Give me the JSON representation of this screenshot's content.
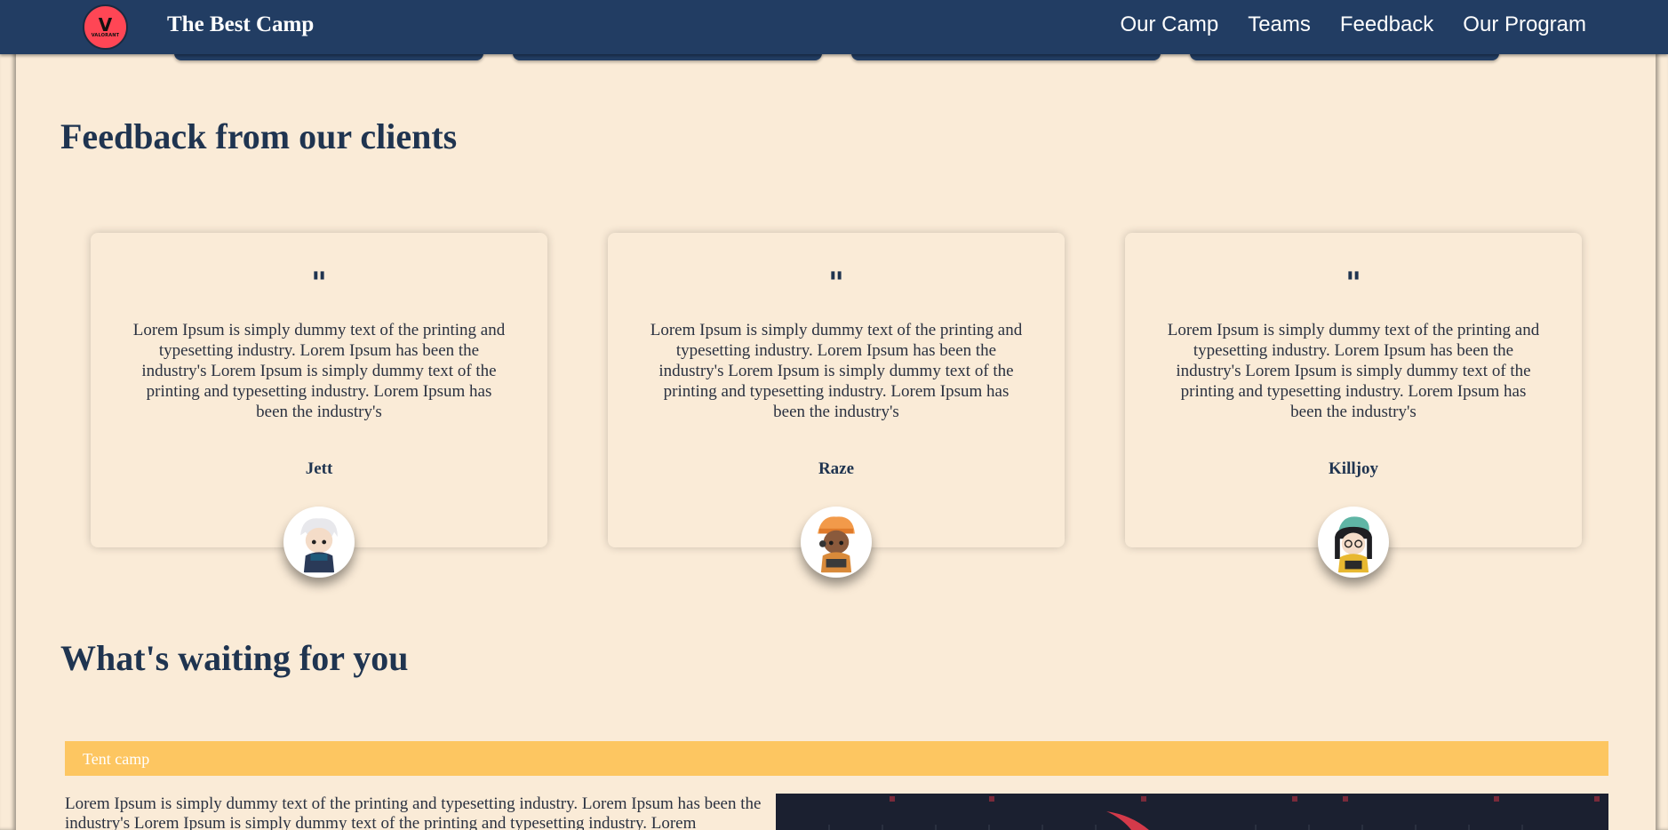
{
  "navbar": {
    "logo_text": "VALORANT",
    "brand": "The Best Camp",
    "links": [
      "Our Camp",
      "Teams",
      "Feedback",
      "Our Program"
    ]
  },
  "feedback": {
    "title": "Feedback from our clients",
    "quote_mark": "\"",
    "cards": [
      {
        "text": "Lorem Ipsum is simply dummy text of the printing and typesetting industry. Lorem Ipsum has been the industry's Lorem Ipsum is simply dummy text of the printing and typesetting industry. Lorem Ipsum has been the industry's",
        "name": "Jett"
      },
      {
        "text": "Lorem Ipsum is simply dummy text of the printing and typesetting industry. Lorem Ipsum has been the industry's Lorem Ipsum is simply dummy text of the printing and typesetting industry. Lorem Ipsum has been the industry's",
        "name": "Raze"
      },
      {
        "text": "Lorem Ipsum is simply dummy text of the printing and typesetting industry. Lorem Ipsum has been the industry's Lorem Ipsum is simply dummy text of the printing and typesetting industry. Lorem Ipsum has been the industry's",
        "name": "Killjoy"
      }
    ]
  },
  "waiting": {
    "title": "What's waiting for you",
    "tent_label": "Tent camp",
    "tent_text": "Lorem Ipsum is simply dummy text of the printing and typesetting industry. Lorem Ipsum has been the industry's Lorem Ipsum is simply dummy text of the printing and typesetting industry. Lorem"
  },
  "colors": {
    "navbar": "#223d63",
    "background": "#faebd7",
    "accent": "#fdc661",
    "logo": "#ff4655"
  }
}
